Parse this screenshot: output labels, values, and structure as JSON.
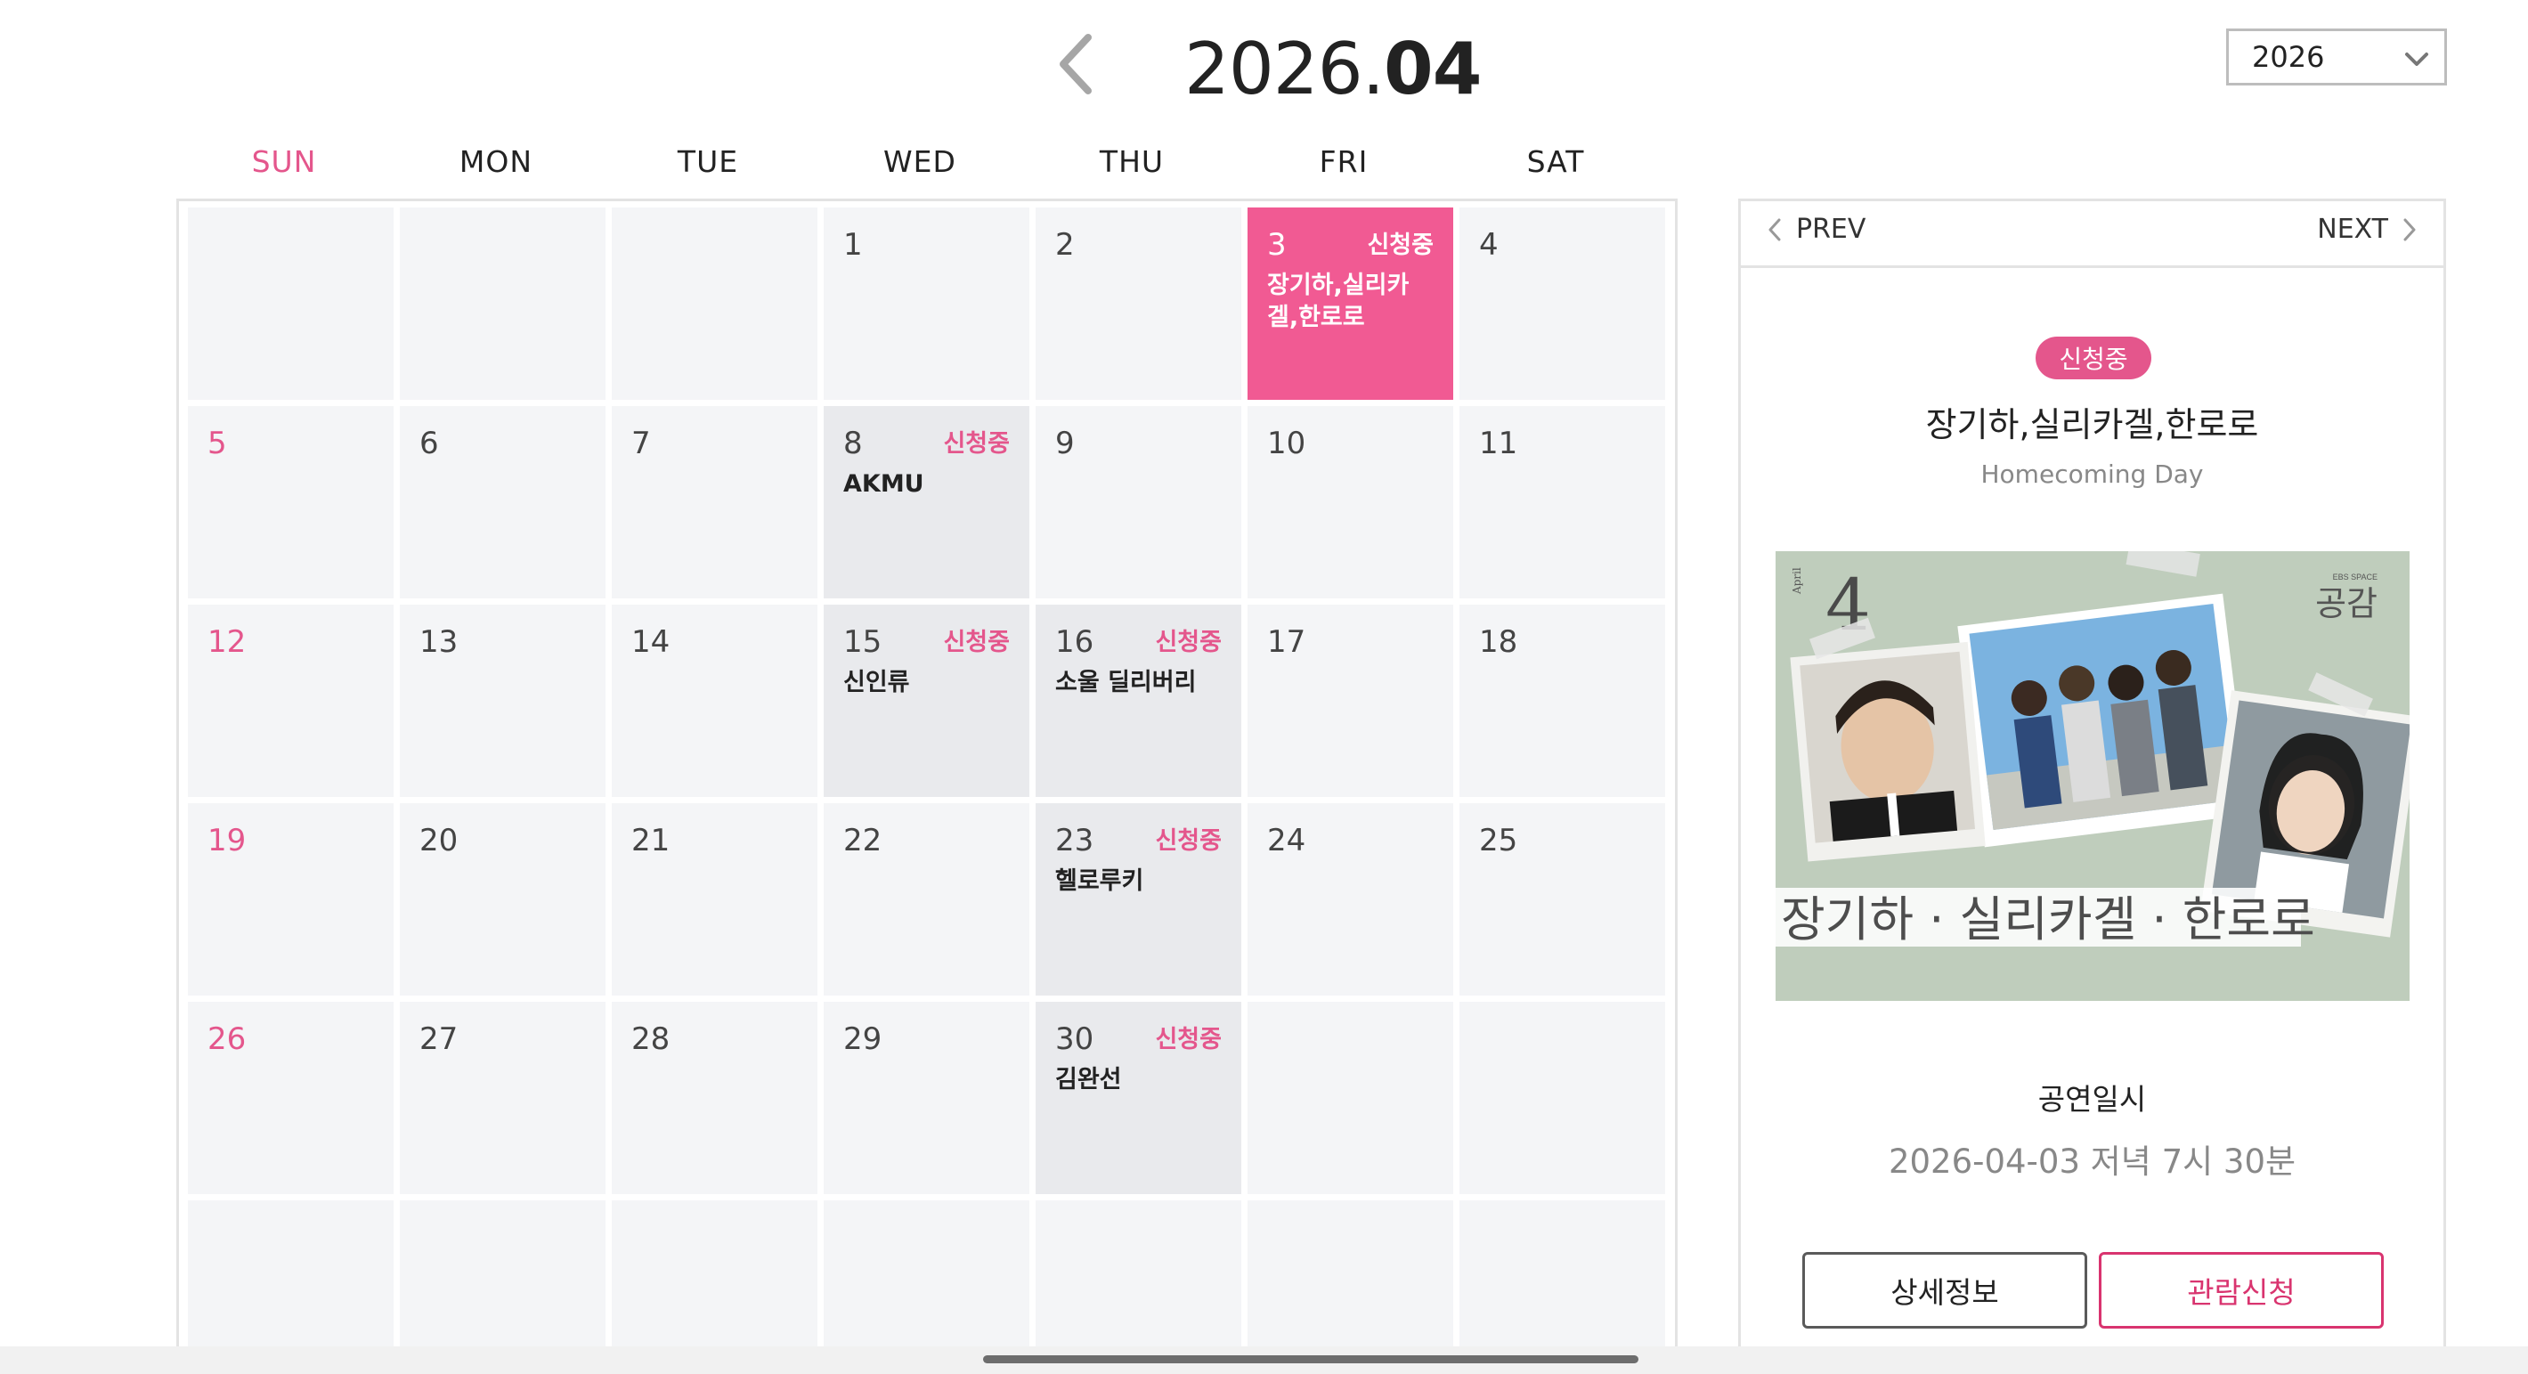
{
  "header": {
    "year": "2026.",
    "month": "04",
    "year_select_value": "2026"
  },
  "weekdays": [
    "SUN",
    "MON",
    "TUE",
    "WED",
    "THU",
    "FRI",
    "SAT"
  ],
  "weeks": [
    [
      {
        "day": ""
      },
      {
        "day": ""
      },
      {
        "day": ""
      },
      {
        "day": "1"
      },
      {
        "day": "2"
      },
      {
        "day": "3",
        "status": "신청중",
        "title": "장기하,실리카겔,한로로",
        "selected": true
      },
      {
        "day": "4"
      }
    ],
    [
      {
        "day": "5"
      },
      {
        "day": "6"
      },
      {
        "day": "7"
      },
      {
        "day": "8",
        "status": "신청중",
        "title": "AKMU"
      },
      {
        "day": "9"
      },
      {
        "day": "10"
      },
      {
        "day": "11"
      }
    ],
    [
      {
        "day": "12"
      },
      {
        "day": "13"
      },
      {
        "day": "14"
      },
      {
        "day": "15",
        "status": "신청중",
        "title": "신인류"
      },
      {
        "day": "16",
        "status": "신청중",
        "title": "소울 딜리버리"
      },
      {
        "day": "17"
      },
      {
        "day": "18"
      }
    ],
    [
      {
        "day": "19"
      },
      {
        "day": "20"
      },
      {
        "day": "21"
      },
      {
        "day": "22"
      },
      {
        "day": "23",
        "status": "신청중",
        "title": "헬로루키"
      },
      {
        "day": "24"
      },
      {
        "day": "25"
      }
    ],
    [
      {
        "day": "26"
      },
      {
        "day": "27"
      },
      {
        "day": "28"
      },
      {
        "day": "29"
      },
      {
        "day": "30",
        "status": "신청중",
        "title": "김완선"
      },
      {
        "day": ""
      },
      {
        "day": ""
      }
    ],
    [
      {
        "day": ""
      },
      {
        "day": ""
      },
      {
        "day": ""
      },
      {
        "day": ""
      },
      {
        "day": ""
      },
      {
        "day": ""
      },
      {
        "day": ""
      }
    ]
  ],
  "panel": {
    "prev_label": "PREV",
    "next_label": "NEXT",
    "badge": "신청중",
    "title": "장기하,실리카겔,한로로",
    "subtitle": "Homecoming Day",
    "poster": {
      "month_small": "April",
      "month_num": "4",
      "logo_small": "EBS SPACE",
      "logo": "공감",
      "caption": "장기하 · 실리카겔 · 한로로"
    },
    "date_label": "공연일시",
    "date_value": "2026-04-03 저녁 7시 30분",
    "detail_button": "상세정보",
    "apply_button": "관람신청"
  },
  "colors": {
    "accent_pink": "#f15a93",
    "status_pink": "#e4568c",
    "apply_border": "#d9346f",
    "cell_bg": "#f4f5f7",
    "cell_event_bg": "#e9eaed"
  }
}
